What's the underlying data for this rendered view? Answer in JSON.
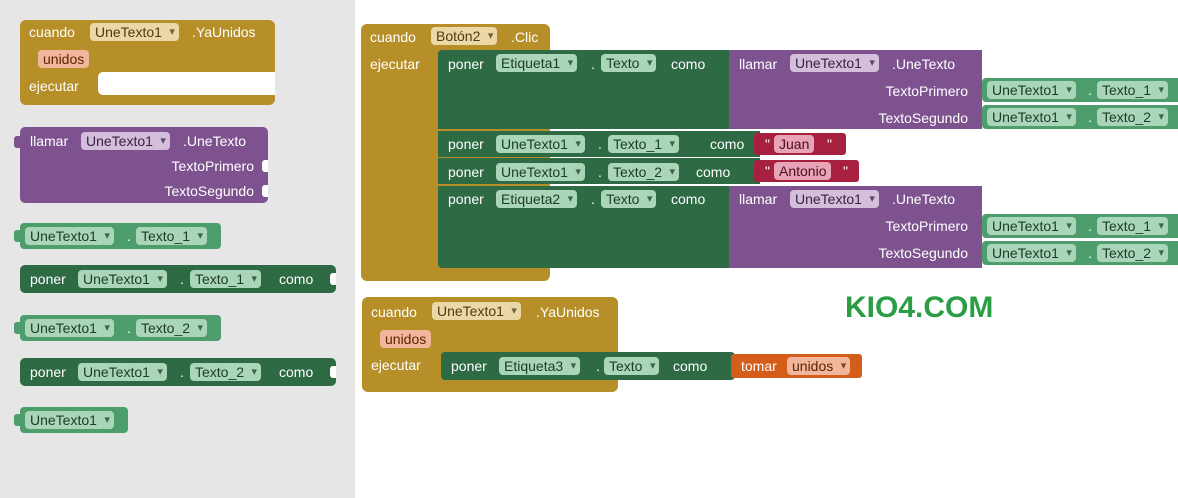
{
  "palette": {
    "event_gold": "#b68f28",
    "procedure_purple": "#7d528f",
    "setter_green": "#2e6a44",
    "getter_green": "#4e9d6c",
    "text_red": "#a8203f",
    "local_orange": "#d45d19",
    "watermark_green": "#2a9d45",
    "drawer_gray": "#e6e6e6"
  },
  "drawer": {
    "event": {
      "cuando": "cuando",
      "component": "UneTexto1",
      "event_name": ".YaUnidos",
      "param": "unidos",
      "ejecutar": "ejecutar"
    },
    "call": {
      "llamar": "llamar",
      "component": "UneTexto1",
      "method": ".UneTexto",
      "arg1": "TextoPrimero",
      "arg2": "TextoSegundo"
    },
    "getter1": {
      "component": "UneTexto1",
      "dot": ".",
      "property": "Texto_1"
    },
    "setter1": {
      "poner": "poner",
      "component": "UneTexto1",
      "dot": ".",
      "property": "Texto_1",
      "como": "como"
    },
    "getter2": {
      "component": "UneTexto1",
      "dot": ".",
      "property": "Texto_2"
    },
    "setter2": {
      "poner": "poner",
      "component": "UneTexto1",
      "dot": ".",
      "property": "Texto_2",
      "como": "como"
    },
    "component_block": {
      "component": "UneTexto1"
    }
  },
  "workspace": {
    "click_event": {
      "cuando": "cuando",
      "component": "Botón2",
      "event_name": ".Clic",
      "ejecutar": "ejecutar",
      "stmt1": {
        "poner": "poner",
        "component": "Etiqueta1",
        "dot": ".",
        "property": "Texto",
        "como": "como",
        "call": {
          "llamar": "llamar",
          "component": "UneTexto1",
          "method": ".UneTexto",
          "arg1": "TextoPrimero",
          "arg2": "TextoSegundo",
          "get1": {
            "component": "UneTexto1",
            "dot": ".",
            "property": "Texto_1"
          },
          "get2": {
            "component": "UneTexto1",
            "dot": ".",
            "property": "Texto_2"
          }
        }
      },
      "stmt2": {
        "poner": "poner",
        "component": "UneTexto1",
        "dot": ".",
        "property": "Texto_1",
        "como": "como",
        "q_open": "\"",
        "value": "Juan",
        "q_close": "\""
      },
      "stmt3": {
        "poner": "poner",
        "component": "UneTexto1",
        "dot": ".",
        "property": "Texto_2",
        "como": "como",
        "q_open": "\"",
        "value": "Antonio",
        "q_close": "\""
      },
      "stmt4": {
        "poner": "poner",
        "component": "Etiqueta2",
        "dot": ".",
        "property": "Texto",
        "como": "como",
        "call": {
          "llamar": "llamar",
          "component": "UneTexto1",
          "method": ".UneTexto",
          "arg1": "TextoPrimero",
          "arg2": "TextoSegundo",
          "get1": {
            "component": "UneTexto1",
            "dot": ".",
            "property": "Texto_1"
          },
          "get2": {
            "component": "UneTexto1",
            "dot": ".",
            "property": "Texto_2"
          }
        }
      }
    },
    "joined_event": {
      "cuando": "cuando",
      "component": "UneTexto1",
      "event_name": ".YaUnidos",
      "param": "unidos",
      "ejecutar": "ejecutar",
      "stmt": {
        "poner": "poner",
        "component": "Etiqueta3",
        "dot": ".",
        "property": "Texto",
        "como": "como",
        "tomar": "tomar",
        "var": "unidos"
      }
    },
    "watermark": "KIO4.COM"
  }
}
